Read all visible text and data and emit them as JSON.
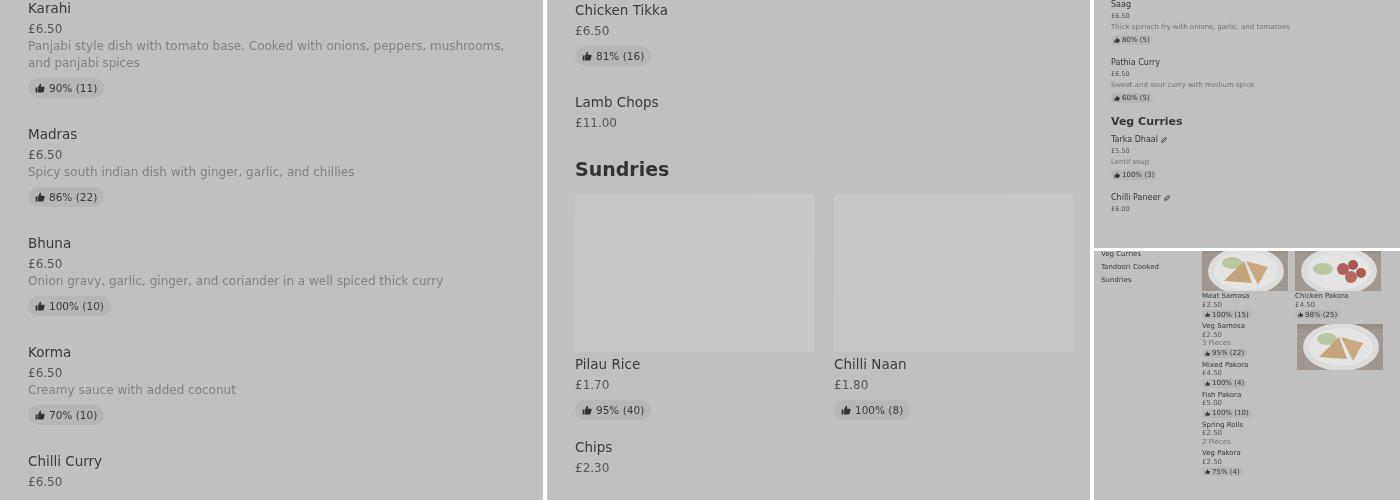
{
  "screenshots": [
    {
      "kind": "menu",
      "items": [
        {
          "kind": "dish",
          "name": "Karahi",
          "price": "£6.50",
          "description": "Panjabi style dish with tomato base. Cooked with onions, peppers, mushrooms, and panjabi spices",
          "rating": "90% (11)"
        },
        {
          "kind": "dish",
          "name": "Madras",
          "price": "£6.50",
          "description": "Spicy south indian dish with ginger, garlic, and chillies",
          "rating": "86% (22)"
        },
        {
          "kind": "dish",
          "name": "Bhuna",
          "price": "£6.50",
          "description": "Onion gravy, garlic, ginger, and coriander in a well spiced thick curry",
          "rating": "100% (10)"
        },
        {
          "kind": "dish",
          "name": "Korma",
          "price": "£6.50",
          "description": "Creamy sauce with added coconut",
          "rating": "70% (10)"
        },
        {
          "kind": "dish",
          "name": "Chilli Curry",
          "price": "£6.50"
        }
      ]
    },
    {
      "kind": "menu",
      "items": [
        {
          "kind": "dish",
          "name": "Chicken Tikka",
          "price": "£6.50",
          "rating": "81% (16)"
        },
        {
          "kind": "dish",
          "name": "Lamb Chops",
          "price": "£11.00"
        },
        {
          "kind": "heading",
          "text": "Sundries"
        },
        {
          "kind": "grid",
          "items": [
            {
              "kind": "dish_card",
              "name": "Pilau Rice",
              "price": "£1.70",
              "rating": "95% (40)"
            },
            {
              "kind": "dish_card",
              "name": "Chilli Naan",
              "price": "£1.80",
              "rating": "100% (8)"
            },
            {
              "kind": "dish",
              "name": "Chips",
              "price": "£2.30"
            }
          ]
        }
      ]
    },
    {
      "kind": "menu_compact",
      "items": [
        {
          "kind": "dish",
          "name": "Saag",
          "price": "£6.50",
          "description": "Thick spinach fry with onions, garlic, and tomatoes",
          "rating": "80% (5)",
          "vegetarian": false
        },
        {
          "kind": "dish",
          "name": "Pathia Curry",
          "price": "£6.50",
          "description": "Sweet and sour curry with medium spice",
          "rating": "60% (5)",
          "vegetarian": false
        },
        {
          "kind": "heading",
          "text": "Veg Curries"
        },
        {
          "kind": "dish",
          "name": "Tarka Dhaal",
          "price": "£5.50",
          "description": "Lentil soup",
          "rating": "100% (3)",
          "vegetarian": true
        },
        {
          "kind": "dish",
          "name": "Chilli Paneer",
          "price": "£6.00",
          "vegetarian": true
        }
      ]
    },
    {
      "kind": "menu_sidebar",
      "categories": [
        {
          "label": "Veg Curries"
        },
        {
          "label": "Tandoori Cooked"
        },
        {
          "label": "Sundries"
        }
      ],
      "columns": [
        [
          {
            "kind": "picture"
          },
          {
            "kind": "dish",
            "name": "Meat Samosa",
            "price": "£2.50",
            "rating": "100% (15)"
          },
          {
            "kind": "dish",
            "name": "Veg Samosa",
            "price": "£2.50",
            "description": "3 Pieces",
            "rating": "95% (22)"
          },
          {
            "kind": "dish",
            "name": "Mixed Pakora",
            "price": "£4.50",
            "rating": "100% (4)"
          },
          {
            "kind": "dish",
            "name": "Fish Pakora",
            "price": "£5.00",
            "rating": "100% (10)"
          },
          {
            "kind": "dish",
            "name": "Spring Rolls",
            "price": "£2.50",
            "description": "2 Pieces"
          },
          {
            "kind": "dish",
            "name": "Veg Pakora",
            "price": "£2.50",
            "rating": "75% (4)"
          }
        ],
        [
          {
            "kind": "picture"
          },
          {
            "kind": "dish",
            "name": "Chicken Pakora",
            "price": "£4.50",
            "rating": "98% (25)"
          },
          {
            "kind": "picture"
          }
        ]
      ]
    }
  ]
}
